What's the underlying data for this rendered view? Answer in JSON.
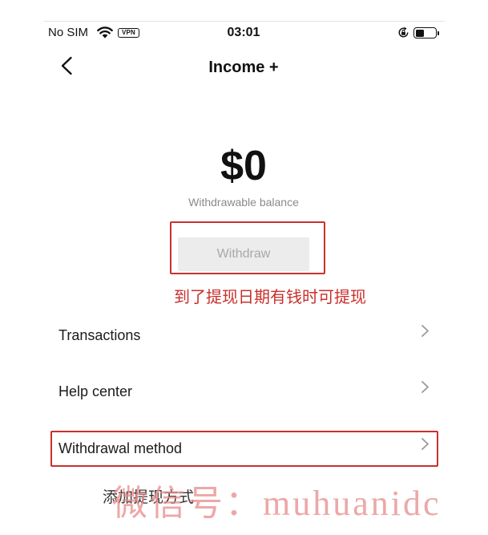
{
  "status_bar": {
    "carrier": "No SIM",
    "vpn_label": "VPN",
    "time": "03:01",
    "battery_level": 0.45,
    "icons": {
      "wifi": "wifi-icon",
      "orientation_lock": "orientation-lock-icon",
      "battery": "battery-icon"
    }
  },
  "header": {
    "title": "Income +",
    "back_icon": "chevron-left-icon"
  },
  "balance": {
    "amount": "$0",
    "label": "Withdrawable balance"
  },
  "withdraw_button": {
    "label": "Withdraw"
  },
  "menu": {
    "items": [
      {
        "label": "Transactions"
      },
      {
        "label": "Help center"
      },
      {
        "label": "Withdrawal method"
      }
    ],
    "chevron_icon": "chevron-right-icon"
  },
  "annotations": {
    "withdraw_note": "到了提现日期有钱时可提现",
    "method_note": "添加提现方式",
    "color": "#c9302c"
  },
  "watermark": {
    "text": "微信号：muhuanidc",
    "color": "#e88a8a"
  }
}
